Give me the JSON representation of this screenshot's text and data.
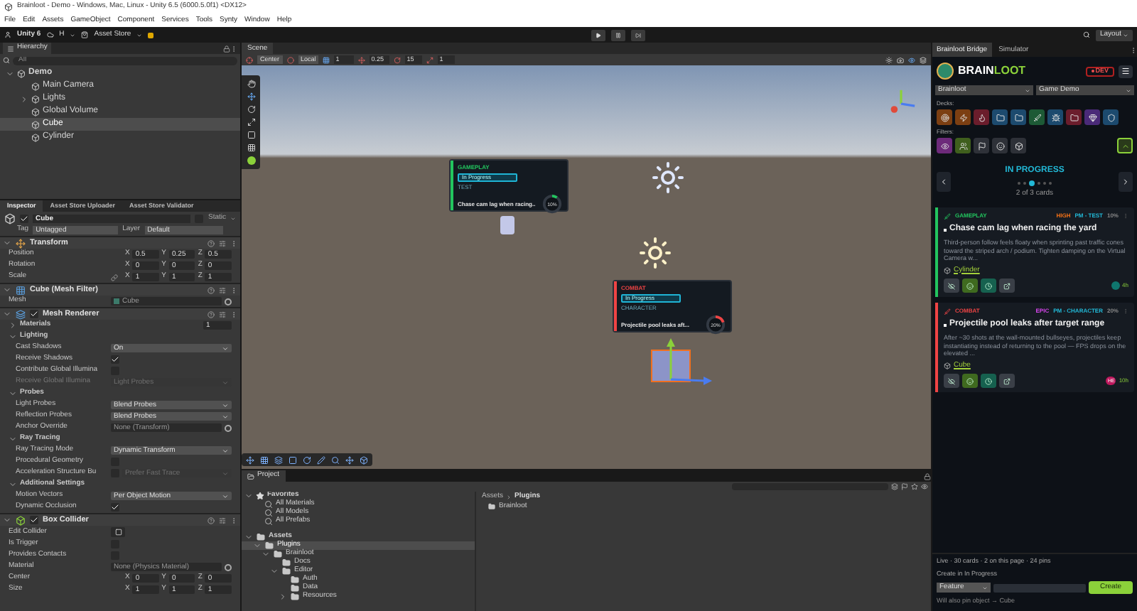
{
  "window": {
    "title": "Brainloot - Demo - Windows, Mac, Linux - Unity 6.5 (6000.5.0f1) <DX12>"
  },
  "menu": [
    "File",
    "Edit",
    "Assets",
    "GameObject",
    "Component",
    "Services",
    "Tools",
    "Synty",
    "Window",
    "Help"
  ],
  "toolbar": {
    "account": "Unity 6",
    "cloud": "H",
    "store": "Asset Store",
    "layout": "Layout"
  },
  "hierarchy": {
    "title": "Hierarchy",
    "search_placeholder": "All",
    "items": [
      {
        "label": "Demo",
        "expanded": true,
        "selected": false,
        "children": [
          {
            "label": "Main Camera",
            "selected": false
          },
          {
            "label": "Lights",
            "expanded": false,
            "selected": false
          },
          {
            "label": "Global Volume",
            "selected": false
          },
          {
            "label": "Cube",
            "selected": true
          },
          {
            "label": "Cylinder",
            "selected": false
          }
        ]
      }
    ]
  },
  "inspector": {
    "tabs": [
      {
        "label": "Inspector",
        "selected": true
      },
      {
        "label": "Asset Store Uploader",
        "selected": false
      },
      {
        "label": "Asset Store Validator",
        "selected": false
      }
    ],
    "object": {
      "name": "Cube",
      "active": true,
      "static_label": "Static",
      "static": false,
      "tag_label": "Tag",
      "tag": "Untagged",
      "layer_label": "Layer",
      "layer": "Default"
    },
    "components": [
      {
        "title": "Transform",
        "kind": "plain",
        "rows": [
          {
            "kind": "vector",
            "label": "Position",
            "values": [
              {
                "axis": "X",
                "value": "0.5"
              },
              {
                "axis": "Y",
                "value": "0.25"
              },
              {
                "axis": "Z",
                "value": "0.5"
              }
            ]
          },
          {
            "kind": "vector",
            "label": "Rotation",
            "values": [
              {
                "axis": "X",
                "value": "0"
              },
              {
                "axis": "Y",
                "value": "0"
              },
              {
                "axis": "Z",
                "value": "0"
              }
            ]
          },
          {
            "kind": "vector",
            "label": "Scale",
            "linked": true,
            "values": [
              {
                "axis": "X",
                "value": "1"
              },
              {
                "axis": "Y",
                "value": "1"
              },
              {
                "axis": "Z",
                "value": "1"
              }
            ]
          }
        ]
      },
      {
        "title": "Cube (Mesh Filter)",
        "kind": "plain",
        "rows": [
          {
            "kind": "object",
            "label": "Mesh",
            "value": "Cube"
          }
        ]
      },
      {
        "title": "Mesh Renderer",
        "kind": "toggle",
        "enabled": true,
        "rows": [
          {
            "kind": "number",
            "label": "Materials",
            "value": "1",
            "expanded": false
          },
          {
            "kind": "section",
            "label": "Lighting",
            "expanded": true,
            "children": [
              {
                "kind": "dropdown",
                "label": "Cast Shadows",
                "value": "On",
                "disabled": false
              },
              {
                "kind": "check",
                "label": "Receive Shadows",
                "checked": true,
                "disabled": false
              },
              {
                "kind": "check",
                "label": "Contribute Global Illumina",
                "checked": false,
                "disabled": false
              },
              {
                "kind": "dropdown",
                "label": "Receive Global Illumina",
                "value": "Light Probes",
                "disabled": true
              }
            ]
          },
          {
            "kind": "section",
            "label": "Probes",
            "expanded": true,
            "children": [
              {
                "kind": "dropdown",
                "label": "Light Probes",
                "value": "Blend Probes",
                "disabled": false
              },
              {
                "kind": "dropdown",
                "label": "Reflection Probes",
                "value": "Blend Probes",
                "disabled": false
              },
              {
                "kind": "object",
                "label": "Anchor Override",
                "value": "None (Transform)"
              }
            ]
          },
          {
            "kind": "section",
            "label": "Ray Tracing",
            "expanded": true,
            "children": [
              {
                "kind": "dropdown",
                "label": "Ray Tracing Mode",
                "value": "Dynamic Transform",
                "disabled": false
              },
              {
                "kind": "check",
                "label": "Procedural Geometry",
                "checked": false,
                "disabled": false
              },
              {
                "kind": "check_dropdown",
                "label": "Acceleration Structure Bu",
                "checked": false,
                "value": "Prefer Fast Trace",
                "disabled": true
              }
            ]
          },
          {
            "kind": "section",
            "label": "Additional Settings",
            "expanded": true,
            "children": [
              {
                "kind": "dropdown",
                "label": "Motion Vectors",
                "value": "Per Object Motion",
                "disabled": false
              },
              {
                "kind": "check",
                "label": "Dynamic Occlusion",
                "checked": true,
                "disabled": false
              }
            ]
          }
        ]
      },
      {
        "title": "Box Collider",
        "kind": "toggle",
        "enabled": true,
        "rows": [
          {
            "kind": "button",
            "label": "Edit Collider"
          },
          {
            "kind": "check",
            "label": "Is Trigger",
            "checked": false,
            "disabled": false
          },
          {
            "kind": "check",
            "label": "Provides Contacts",
            "checked": false,
            "disabled": false
          },
          {
            "kind": "object",
            "label": "Material",
            "value": "None (Physics Material)"
          },
          {
            "kind": "vector",
            "label": "Center",
            "values": [
              {
                "axis": "X",
                "value": "0"
              },
              {
                "axis": "Y",
                "value": "0"
              },
              {
                "axis": "Z",
                "value": "0"
              }
            ]
          },
          {
            "kind": "vector",
            "label": "Size",
            "values": [
              {
                "axis": "X",
                "value": "1"
              },
              {
                "axis": "Y",
                "value": "1"
              },
              {
                "axis": "Z",
                "value": "1"
              }
            ]
          }
        ]
      }
    ]
  },
  "scene": {
    "title": "Scene",
    "pivot": "Center",
    "space": "Local",
    "grid": "1",
    "move_snap": "0.25",
    "rotate_snap": "15",
    "scale_snap": "1",
    "cards": [
      {
        "category": "GAMEPLAY",
        "color": "#22c55e",
        "status": "In Progress",
        "tag": "TEST",
        "title": "Chase cam lag when racing..",
        "progress": "10%",
        "level": 0.1
      },
      {
        "category": "COMBAT",
        "color": "#ef4444",
        "status": "In Progress",
        "tag": "CHARACTER",
        "title": "Projectile pool leaks aft...",
        "progress": "20%",
        "level": 0.2
      }
    ]
  },
  "project": {
    "title": "Project",
    "tree": [
      {
        "label": "Favorites",
        "kind": "favorite",
        "expanded": true,
        "selected": false,
        "children": [
          {
            "label": "All Materials",
            "kind": "search",
            "selected": false
          },
          {
            "label": "All Models",
            "kind": "search",
            "selected": false
          },
          {
            "label": "All Prefabs",
            "kind": "search",
            "selected": false
          }
        ]
      },
      {
        "label": "Assets",
        "kind": "folder",
        "expanded": true,
        "selected": false,
        "children": [
          {
            "label": "Plugins",
            "kind": "folder",
            "expanded": true,
            "selected": true,
            "children": [
              {
                "label": "Brainloot",
                "kind": "folder",
                "expanded": true,
                "selected": false,
                "children": [
                  {
                    "label": "Docs",
                    "kind": "folder",
                    "selected": false
                  },
                  {
                    "label": "Editor",
                    "kind": "folder",
                    "expanded": true,
                    "selected": false,
                    "children": [
                      {
                        "label": "Auth",
                        "kind": "folder",
                        "selected": false
                      },
                      {
                        "label": "Data",
                        "kind": "folder",
                        "selected": false
                      },
                      {
                        "label": "Resources",
                        "kind": "folder",
                        "expanded": false,
                        "selected": false
                      }
                    ]
                  }
                ]
              }
            ]
          }
        ]
      }
    ],
    "breadcrumb": [
      "Assets",
      "Plugins"
    ],
    "items": [
      "Brainloot"
    ]
  },
  "bridge": {
    "tabs": [
      {
        "label": "Brainloot Bridge",
        "selected": true
      },
      {
        "label": "Simulator",
        "selected": false
      }
    ],
    "logo_left": "BRAIN",
    "logo_right": "LOOT",
    "env": "DEV",
    "workspace": "Brainloot",
    "project": "Game Demo",
    "decks_label": "Decks:",
    "decks": [
      {
        "color": "#7c3f12"
      },
      {
        "color": "#7c3f12"
      },
      {
        "color": "#6b1d2c"
      },
      {
        "color": "#1c4a6e"
      },
      {
        "color": "#1c4a6e"
      },
      {
        "color": "#1d5a36"
      },
      {
        "color": "#1c4a6e"
      },
      {
        "color": "#6b1d2c"
      },
      {
        "color": "#4a2a78"
      },
      {
        "color": "#1c4a6e"
      }
    ],
    "filters_label": "Filters:",
    "filters": [
      {
        "color": "#6d2a7a"
      },
      {
        "color": "#3f5f1d"
      },
      {
        "color": "#2e3138"
      },
      {
        "color": "#2e3138"
      },
      {
        "color": "#2e3138"
      }
    ],
    "column": "IN PROGRESS",
    "pages": [
      {
        "selected": false
      },
      {
        "selected": false
      },
      {
        "selected": true
      },
      {
        "selected": false
      },
      {
        "selected": false
      },
      {
        "selected": false
      }
    ],
    "page_info": "2 of 3 cards",
    "cards": [
      {
        "category": "GAMEPLAY",
        "color": "#22c55e",
        "priority": {
          "label": "HIGH",
          "color": "#f97316"
        },
        "tag": "PM - TEST",
        "progress": "10%",
        "title": "Chase cam lag when racing the yard",
        "description": "Third-person follow feels floaty when sprinting past traffic cones toward the striped arch / podium. Tighten damping on the Virtual Camera w...",
        "object": "Cylinder",
        "time": "4h"
      },
      {
        "category": "COMBAT",
        "color": "#ef4444",
        "priority": {
          "label": "EPIC",
          "color": "#d946ef"
        },
        "tag": "PM - CHARACTER",
        "progress": "20%",
        "title": "Projectile pool leaks after target range",
        "description": "After ~30 shots at the wall-mounted bullseyes, projectiles keep instantiating instead of returning to the pool — FPS drops on the elevated ...",
        "object": "Cube",
        "avatar": "HE",
        "time": "10h"
      }
    ],
    "status": "Live · 30 cards · 2 on this page · 24 pins",
    "create_label": "Create in In Progress",
    "type": "Feature",
    "create": "Create",
    "hint": "Will also pin object → Cube"
  }
}
